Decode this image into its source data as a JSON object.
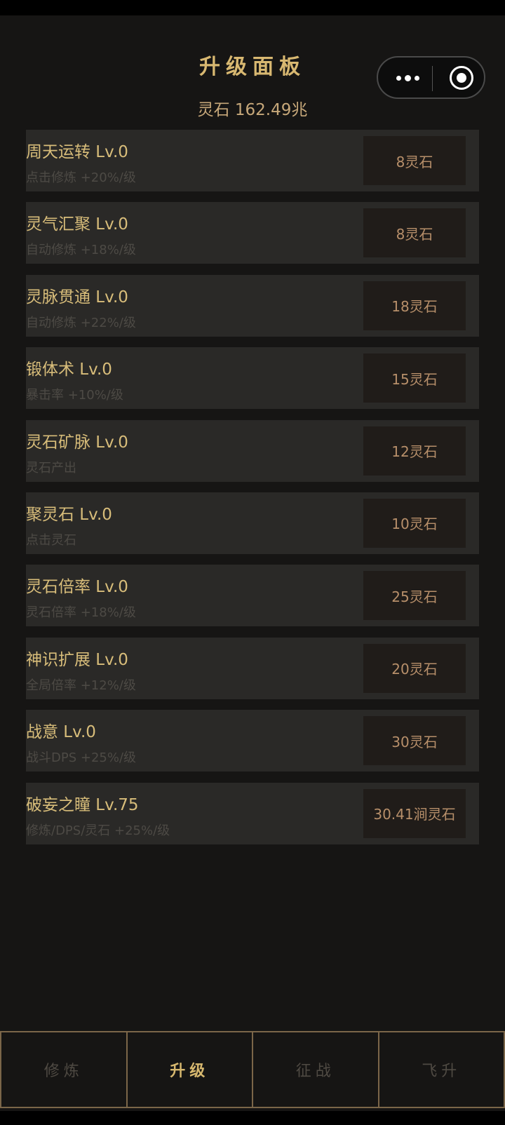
{
  "header": {
    "title": "升级面板",
    "stones": "灵石 162.49兆"
  },
  "upgrades": [
    {
      "name": "周天运转 Lv.0",
      "desc": "点击修炼 +20%/级",
      "cost": "8灵石"
    },
    {
      "name": "灵气汇聚 Lv.0",
      "desc": "自动修炼 +18%/级",
      "cost": "8灵石"
    },
    {
      "name": "灵脉贯通 Lv.0",
      "desc": "自动修炼 +22%/级",
      "cost": "18灵石"
    },
    {
      "name": "锻体术 Lv.0",
      "desc": "暴击率 +10%/级",
      "cost": "15灵石"
    },
    {
      "name": "灵石矿脉 Lv.0",
      "desc": "灵石产出",
      "cost": "12灵石"
    },
    {
      "name": "聚灵石 Lv.0",
      "desc": "点击灵石",
      "cost": "10灵石"
    },
    {
      "name": "灵石倍率 Lv.0",
      "desc": "灵石倍率 +18%/级",
      "cost": "25灵石"
    },
    {
      "name": "神识扩展 Lv.0",
      "desc": "全局倍率 +12%/级",
      "cost": "20灵石"
    },
    {
      "name": "战意 Lv.0",
      "desc": "战斗DPS +25%/级",
      "cost": "30灵石"
    },
    {
      "name": "破妄之瞳 Lv.75",
      "desc": "修炼/DPS/灵石 +25%/级",
      "cost": "30.41涧灵石"
    }
  ],
  "tabs": [
    {
      "label": "修炼",
      "active": false
    },
    {
      "label": "升级",
      "active": true
    },
    {
      "label": "征战",
      "active": false
    },
    {
      "label": "飞升",
      "active": false
    }
  ],
  "icons": {
    "more": "more-dots-icon",
    "close": "target-icon"
  }
}
